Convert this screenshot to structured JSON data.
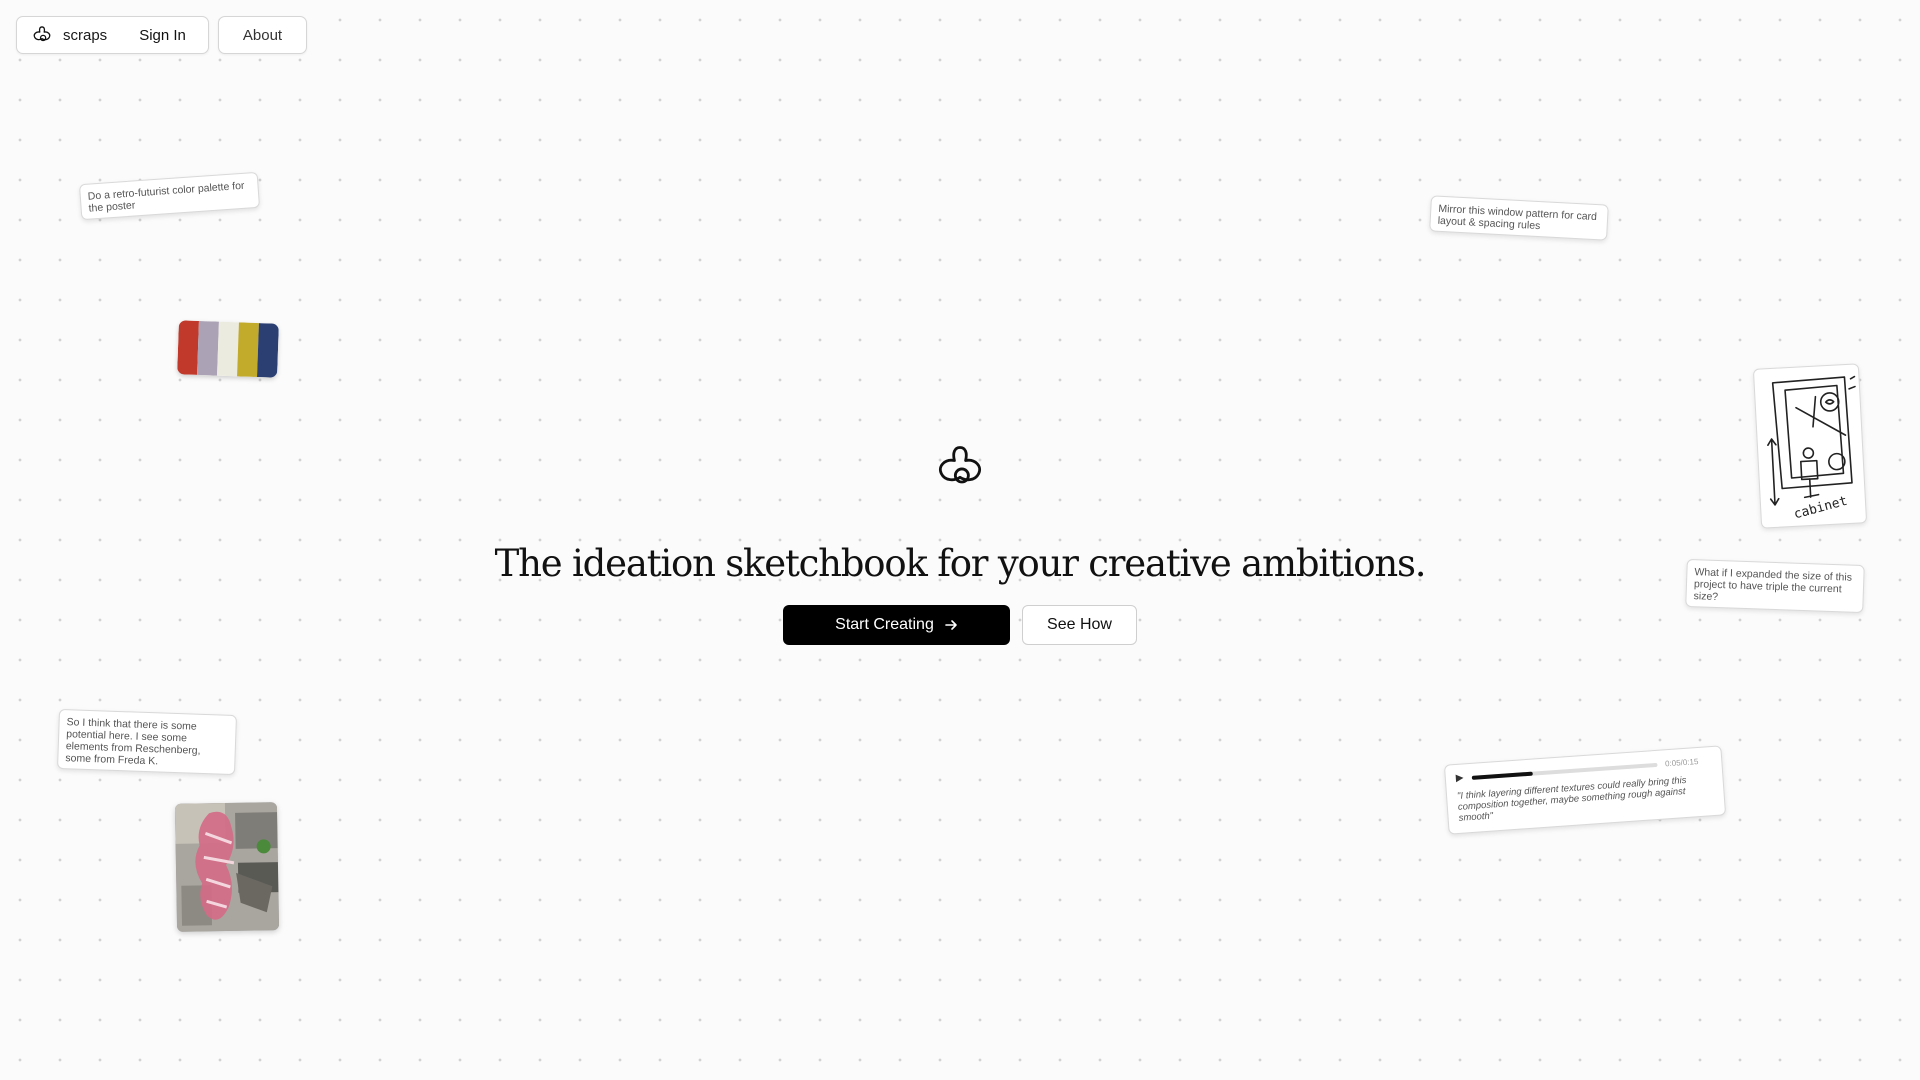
{
  "nav": {
    "brand": "scraps",
    "sign_in": "Sign In",
    "about": "About",
    "logo_icon": "scraps-logo-icon"
  },
  "hero": {
    "logo_icon": "scraps-logo-icon",
    "headline": "The ideation sketchbook for your creative ambitions.",
    "primary_cta": "Start Creating",
    "primary_cta_icon": "arrow-right-icon",
    "secondary_cta": "See How"
  },
  "cards": {
    "retro_note": "Do a retro-futurist color palette for the poster",
    "window_note": "Mirror this window pattern for card layout & spacing rules",
    "triple_note": "What if I expanded the size of this project to have triple the current size?",
    "potential_note": "So I think that there is some potential here. I see some elements from Reschenberg, some from Freda K.",
    "sketch_label": "cabinet"
  },
  "palette": {
    "colors": [
      "#c0392b",
      "#aba2b5",
      "#ecebe0",
      "#c2ab2b",
      "#2b3f72"
    ]
  },
  "audio": {
    "time": "0:05/0:15",
    "progress": 0.33,
    "quote": "\"I think layering different textures could really bring this composition together, maybe something rough against smooth\"",
    "play_icon": "play-icon"
  },
  "colors": {
    "background": "#fbfbfb",
    "primary_button": "#000000",
    "text": "#111111"
  }
}
